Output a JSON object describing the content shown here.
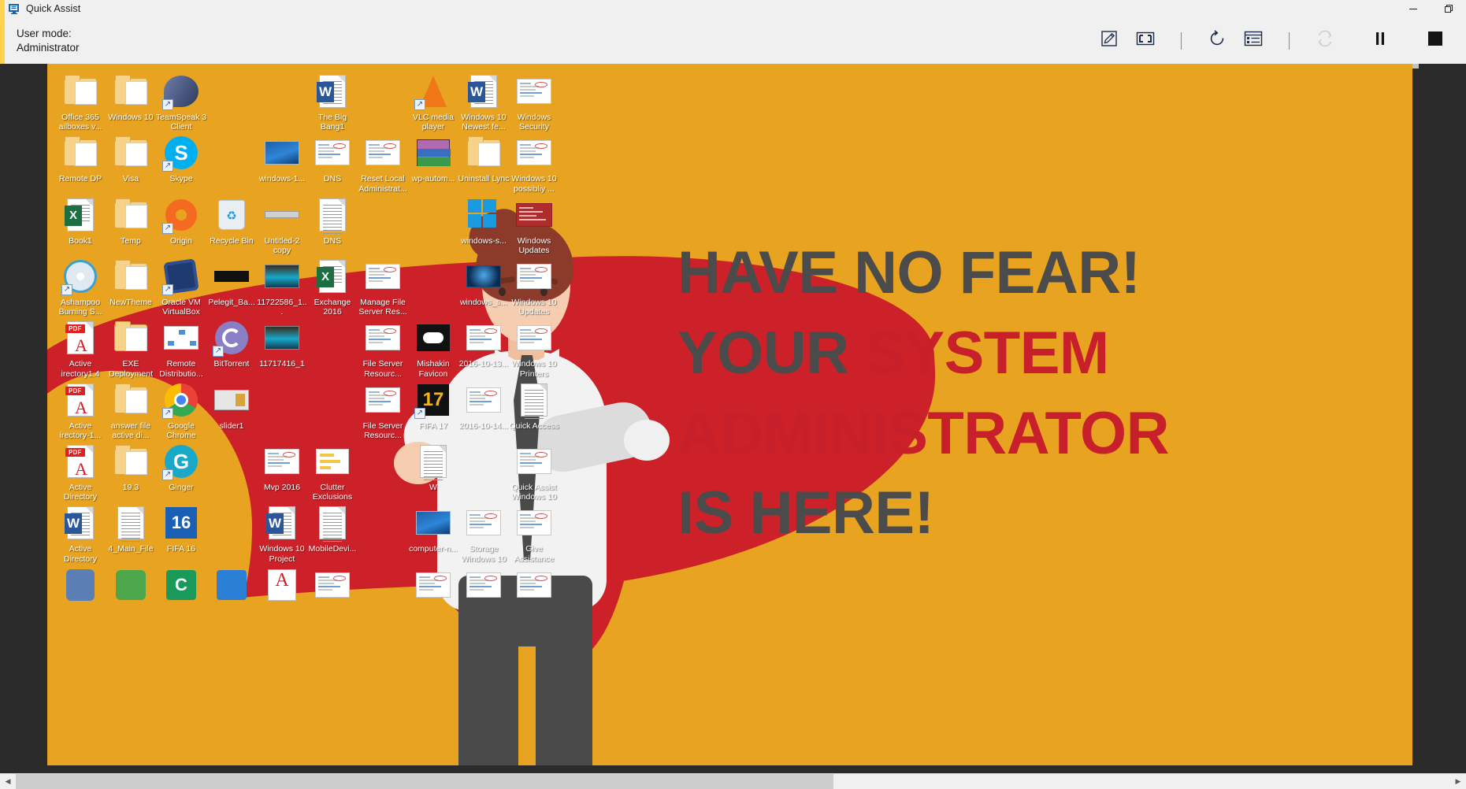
{
  "window": {
    "title": "Quick Assist",
    "app_icon": "quick-assist-monitor-icon",
    "minimize_label": "Minimize",
    "restore_label": "Restore Down",
    "accent_color": "#ffd24d"
  },
  "toolbar": {
    "user_mode_label": "User mode:",
    "user_mode_value": "Administrator",
    "buttons": [
      {
        "name": "annotate",
        "icon": "pencil-square-icon",
        "enabled": true
      },
      {
        "name": "fit-to-screen",
        "icon": "fit-screen-icon",
        "enabled": true
      },
      {
        "name": "restart",
        "icon": "refresh-circle-arrow-icon",
        "enabled": true
      },
      {
        "name": "instruction-channel",
        "icon": "task-list-panel-icon",
        "enabled": true
      },
      {
        "name": "toggle-control",
        "icon": "two-arrow-swap-icon",
        "enabled": false
      },
      {
        "name": "pause",
        "icon": "pause-icon",
        "enabled": true
      },
      {
        "name": "end",
        "icon": "stop-square-icon",
        "enabled": true
      }
    ]
  },
  "remote": {
    "wallpaper": {
      "lines": [
        {
          "segments": [
            {
              "text": "HAVE NO FEAR!",
              "accent": false
            }
          ]
        },
        {
          "segments": [
            {
              "text": "YOUR ",
              "accent": false
            },
            {
              "text": "SYSTEM",
              "accent": true
            }
          ]
        },
        {
          "segments": [
            {
              "text": "ADMINISTRATOR",
              "accent": true
            }
          ]
        },
        {
          "segments": [
            {
              "text": "IS HERE!",
              "accent": false
            }
          ]
        }
      ],
      "bg_color": "#e8a421",
      "accent_color": "#c8202b",
      "text_color": "#4b4b4b"
    },
    "desktop_icons": [
      [
        {
          "label": "Office 365 ailboxes v...",
          "icon": "folder-icon"
        },
        {
          "label": "Windows 10",
          "icon": "folder-icon"
        },
        {
          "label": "TeamSpeak 3 Client",
          "icon": "teamspeak-icon",
          "shortcut": true
        },
        {
          "label": "",
          "icon": "blank"
        },
        {
          "label": "",
          "icon": "blank"
        },
        {
          "label": "The Big Bang1",
          "icon": "word-doc-icon"
        },
        {
          "label": "",
          "icon": "blank"
        },
        {
          "label": "VLC media player",
          "icon": "vlc-cone-icon",
          "shortcut": true
        },
        {
          "label": "Windows 10 Newest fe...",
          "icon": "word-doc-icon"
        },
        {
          "label": "Windows Security",
          "icon": "screenshot-icon"
        }
      ],
      [
        {
          "label": "Remote DP",
          "icon": "folder-icon"
        },
        {
          "label": "Visa",
          "icon": "folder-icon"
        },
        {
          "label": "Skype",
          "icon": "skype-icon",
          "shortcut": true
        },
        {
          "label": "",
          "icon": "blank"
        },
        {
          "label": "windows-1...",
          "icon": "image-icon"
        },
        {
          "label": "DNS",
          "icon": "screenshot-icon"
        },
        {
          "label": "Reset Local Administrat...",
          "icon": "screenshot-icon"
        },
        {
          "label": "wp-autom...",
          "icon": "winrar-icon"
        },
        {
          "label": "Uninstall Lync",
          "icon": "folder-icon"
        },
        {
          "label": "Windows 10 possibliy ...",
          "icon": "screenshot-icon"
        }
      ],
      [
        {
          "label": "Book1",
          "icon": "excel-icon"
        },
        {
          "label": "Temp",
          "icon": "folder-icon"
        },
        {
          "label": "Origin",
          "icon": "origin-icon",
          "shortcut": true
        },
        {
          "label": "Recycle Bin",
          "icon": "recycle-bin-icon"
        },
        {
          "label": "Untitled-2 copy",
          "icon": "thin-image-icon"
        },
        {
          "label": "DNS",
          "icon": "text-doc-icon"
        },
        {
          "label": "",
          "icon": "blank"
        },
        {
          "label": "",
          "icon": "blank"
        },
        {
          "label": "windows-s...",
          "icon": "windows-logo-icon"
        },
        {
          "label": "Windows Updates",
          "icon": "red-window-icon"
        }
      ],
      [
        {
          "label": "Ashampoo Burning S...",
          "icon": "ashampoo-disc-icon",
          "shortcut": true
        },
        {
          "label": "NewTheme",
          "icon": "folder-icon"
        },
        {
          "label": "Oracle VM VirtualBox",
          "icon": "virtualbox-icon",
          "shortcut": true
        },
        {
          "label": "Pelegit_Ba...",
          "icon": "black-banner-icon"
        },
        {
          "label": "11722586_1...",
          "icon": "photo-icon"
        },
        {
          "label": "Exchange 2016",
          "icon": "excel-icon"
        },
        {
          "label": "Manage File Server Res...",
          "icon": "screenshot-icon"
        },
        {
          "label": "",
          "icon": "blank"
        },
        {
          "label": "windows_s...",
          "icon": "win-hero-image-icon"
        },
        {
          "label": "Windows 10 Updates",
          "icon": "screenshot-icon"
        }
      ],
      [
        {
          "label": "Active irectory1.4",
          "icon": "pdf-icon"
        },
        {
          "label": "EXE Deployment",
          "icon": "folder-icon"
        },
        {
          "label": "Remote Distributio...",
          "icon": "network-diagram-icon"
        },
        {
          "label": "BitTorrent",
          "icon": "bittorrent-icon",
          "shortcut": true
        },
        {
          "label": "11717416_1",
          "icon": "photo-icon"
        },
        {
          "label": "",
          "icon": "blank"
        },
        {
          "label": "File Server Resourc...",
          "icon": "screenshot-icon"
        },
        {
          "label": "Mishakin Favicon",
          "icon": "gamepad-icon"
        },
        {
          "label": "2016-10-13...",
          "icon": "screenshot-icon"
        },
        {
          "label": "Windows 10 Printers",
          "icon": "screenshot-icon"
        }
      ],
      [
        {
          "label": "Active irectory-1...",
          "icon": "pdf-icon"
        },
        {
          "label": "answer file active di...",
          "icon": "folder-icon"
        },
        {
          "label": "Google Chrome",
          "icon": "chrome-icon",
          "shortcut": true
        },
        {
          "label": "slider1",
          "icon": "slider-image-icon"
        },
        {
          "label": "",
          "icon": "blank"
        },
        {
          "label": "",
          "icon": "blank"
        },
        {
          "label": "File Server Resourc...",
          "icon": "screenshot-icon"
        },
        {
          "label": "FIFA 17",
          "icon": "fifa17-icon",
          "shortcut": true
        },
        {
          "label": "2016-10-14...",
          "icon": "screenshot-icon"
        },
        {
          "label": "Quick Access",
          "icon": "text-doc-icon"
        }
      ],
      [
        {
          "label": "Active Directory",
          "icon": "pdf-icon"
        },
        {
          "label": "19.3",
          "icon": "folder-pdf-icon"
        },
        {
          "label": "Ginger",
          "icon": "ginger-icon",
          "shortcut": true
        },
        {
          "label": "",
          "icon": "blank"
        },
        {
          "label": "Mvp 2016",
          "icon": "screenshot-icon"
        },
        {
          "label": "Clutter Exclusions",
          "icon": "notes-icon"
        },
        {
          "label": "",
          "icon": "blank"
        },
        {
          "label": "W",
          "icon": "text-doc-icon"
        },
        {
          "label": "",
          "icon": "blank"
        },
        {
          "label": "Quick Assist Windows 10",
          "icon": "screenshot-icon"
        }
      ],
      [
        {
          "label": "Active Directory",
          "icon": "word-doc-icon"
        },
        {
          "label": "4_Main_File",
          "icon": "text-doc-icon"
        },
        {
          "label": "FIFA 16",
          "icon": "fifa16-icon"
        },
        {
          "label": "",
          "icon": "blank"
        },
        {
          "label": "Windows 10 Project",
          "icon": "word-doc-icon"
        },
        {
          "label": "MobileDevi...",
          "icon": "xml-doc-icon"
        },
        {
          "label": "",
          "icon": "blank"
        },
        {
          "label": "computer-n...",
          "icon": "image-icon"
        },
        {
          "label": "Storage Windows 10",
          "icon": "screenshot-icon"
        },
        {
          "label": "Give Assistance",
          "icon": "screenshot-icon"
        }
      ],
      [
        {
          "label": "",
          "icon": "person-icon"
        },
        {
          "label": "",
          "icon": "green-app-icon"
        },
        {
          "label": "",
          "icon": "camtasia-icon"
        },
        {
          "label": "",
          "icon": "blue-app-icon"
        },
        {
          "label": "",
          "icon": "acrobat-icon"
        },
        {
          "label": "",
          "icon": "screenshot-icon"
        },
        {
          "label": "",
          "icon": "blank"
        },
        {
          "label": "",
          "icon": "screenshot-icon"
        },
        {
          "label": "",
          "icon": "screenshot-icon"
        },
        {
          "label": "",
          "icon": "screenshot-icon"
        }
      ]
    ]
  },
  "scrollbar": {
    "left_arrow": "◀",
    "right_arrow": "▶",
    "thumb_position_percent": 0,
    "thumb_width_percent": 57
  }
}
